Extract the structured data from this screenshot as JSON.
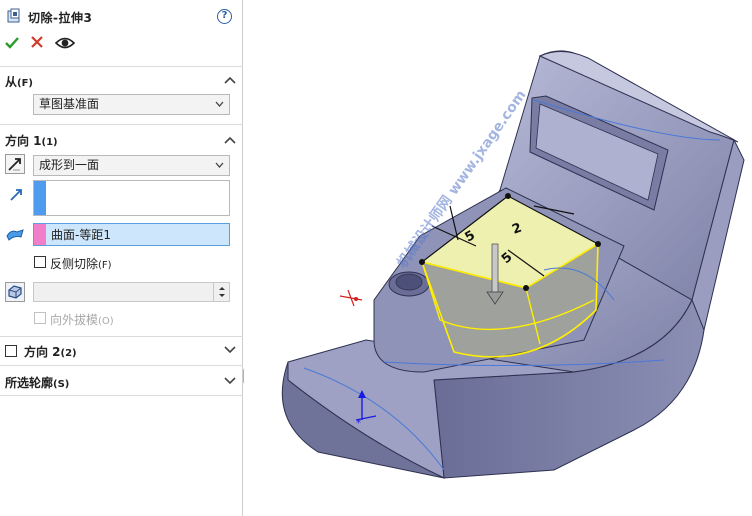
{
  "feature": {
    "title": "切除-拉伸3",
    "help_glyph": "?"
  },
  "from_section": {
    "title": "从",
    "shortcut": "(F)",
    "value": "草图基准面"
  },
  "direction1": {
    "title": "方向 1",
    "shortcut": "(1)",
    "end_condition": "成形到一面",
    "face_value": "曲面-等距1",
    "flip_side_label": "反侧切除",
    "flip_side_shortcut": "(F)",
    "draft_outward_label": "向外拔模",
    "draft_outward_shortcut": "(O)"
  },
  "direction2": {
    "title": "方向 2",
    "shortcut": "(2)"
  },
  "selected_contours": {
    "title": "所选轮廓",
    "shortcut": "(S)"
  },
  "viewport": {
    "watermark": "机械设计师网 www.jxage.com",
    "dim_labels": [
      "5",
      "2",
      "5"
    ],
    "colors": {
      "body": "#8f93b8",
      "body_dark": "#5e6188",
      "sketch_face": "#eef0b0",
      "preview": "#ffef00",
      "edge_blue": "#4a78d8"
    }
  },
  "icons": {
    "ok": "check-icon",
    "cancel": "x-icon",
    "preview": "eye-icon",
    "help": "help-icon",
    "feature": "cut-extrude-icon"
  },
  "colors": {
    "direction_swatch": "#4f9bf0",
    "face_swatch": "#f07ec8",
    "selected_field": "#cde6fb",
    "selected_border": "#5aa0e0"
  }
}
